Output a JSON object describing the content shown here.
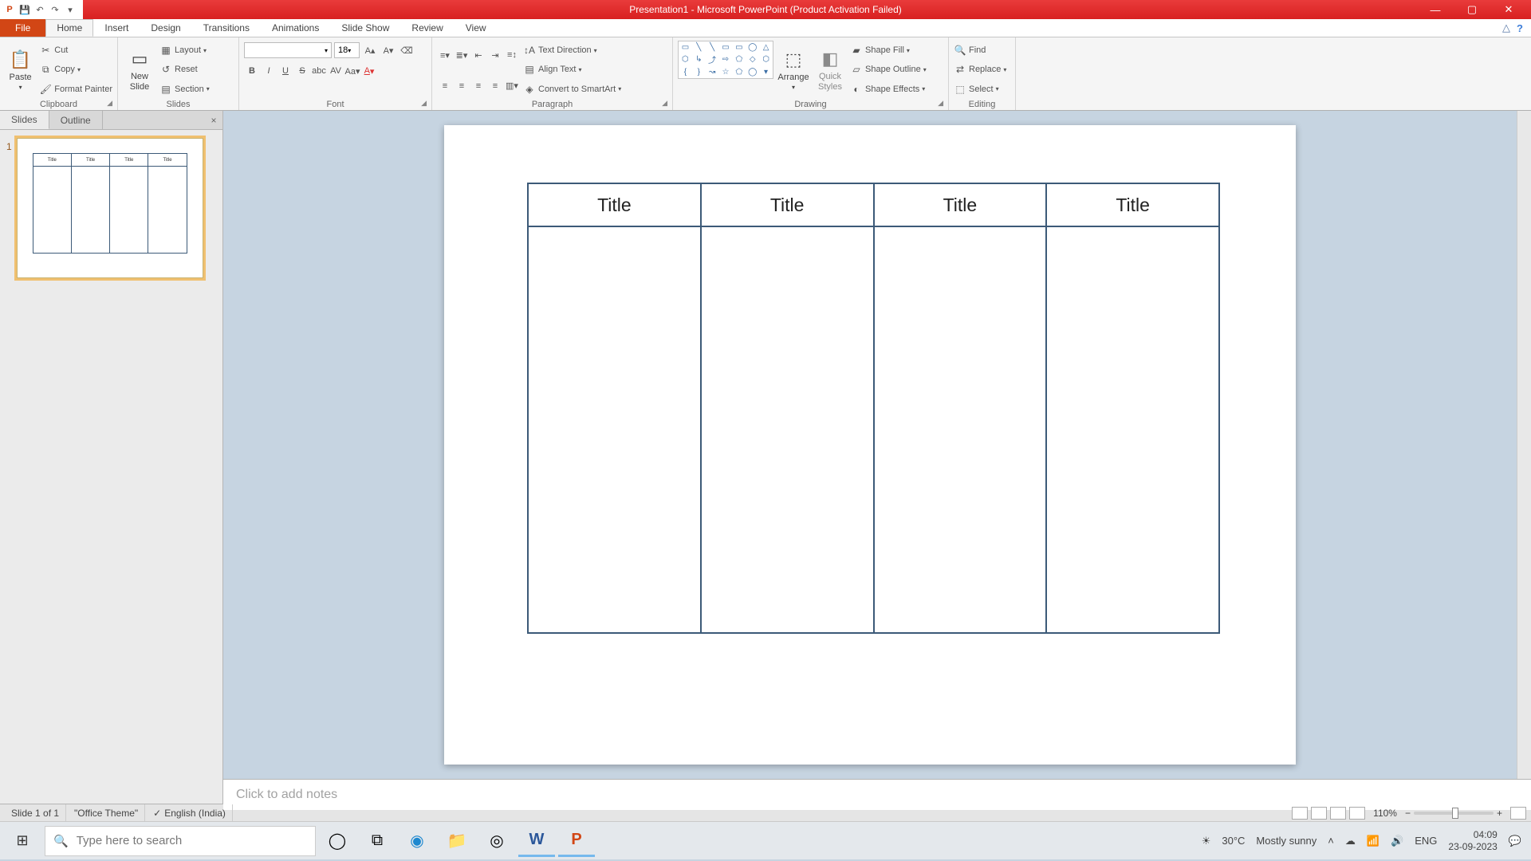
{
  "titlebar": {
    "title": "Presentation1 - Microsoft PowerPoint (Product Activation Failed)"
  },
  "tabs": {
    "file": "File",
    "items": [
      "Home",
      "Insert",
      "Design",
      "Transitions",
      "Animations",
      "Slide Show",
      "Review",
      "View"
    ],
    "active": 0
  },
  "ribbon": {
    "clipboard": {
      "label": "Clipboard",
      "paste": "Paste",
      "cut": "Cut",
      "copy": "Copy",
      "format_painter": "Format Painter"
    },
    "slides": {
      "label": "Slides",
      "new_slide": "New\nSlide",
      "layout": "Layout",
      "reset": "Reset",
      "section": "Section"
    },
    "font": {
      "label": "Font",
      "name": "",
      "size": "18"
    },
    "paragraph": {
      "label": "Paragraph",
      "text_direction": "Text Direction",
      "align_text": "Align Text",
      "convert_smartart": "Convert to SmartArt"
    },
    "drawing": {
      "label": "Drawing",
      "arrange": "Arrange",
      "quick_styles": "Quick\nStyles",
      "shape_fill": "Shape Fill",
      "shape_outline": "Shape Outline",
      "shape_effects": "Shape Effects"
    },
    "editing": {
      "label": "Editing",
      "find": "Find",
      "replace": "Replace",
      "select": "Select"
    }
  },
  "slides_panel": {
    "tab_slides": "Slides",
    "tab_outline": "Outline",
    "thumb_number": "1",
    "thumb_heads": [
      "Title",
      "Title",
      "Title",
      "Title"
    ]
  },
  "slide": {
    "columns": [
      "Title",
      "Title",
      "Title",
      "Title"
    ]
  },
  "notes": {
    "placeholder": "Click to add notes"
  },
  "status": {
    "slide_of": "Slide 1 of 1",
    "theme": "\"Office Theme\"",
    "language": "English (India)",
    "zoom": "110%"
  },
  "taskbar": {
    "search_placeholder": "Type here to search",
    "weather_temp": "30°C",
    "weather_text": "Mostly sunny",
    "time": "04:09",
    "date": "23-09-2023"
  }
}
